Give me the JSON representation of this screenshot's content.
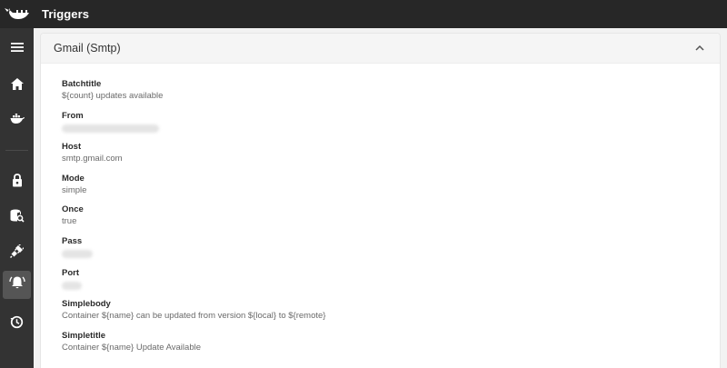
{
  "app": {
    "title": "Triggers",
    "logo_icon": "whale-logo-icon"
  },
  "sidebar": {
    "items": [
      {
        "icon": "menu-icon",
        "active": false
      },
      {
        "icon": "home-icon",
        "active": false
      },
      {
        "icon": "docker-whale-icon",
        "active": false
      },
      {
        "icon": "lock-icon",
        "active": false
      },
      {
        "icon": "database-search-icon",
        "active": false
      },
      {
        "icon": "plug-icon",
        "active": false
      },
      {
        "icon": "bell-alarm-icon",
        "active": true
      },
      {
        "icon": "history-icon",
        "active": false
      }
    ]
  },
  "panel": {
    "title": "Gmail (Smtp)",
    "expanded": true,
    "fields": [
      {
        "label": "Batchtitle",
        "value": "${count} updates available",
        "redacted": false
      },
      {
        "label": "From",
        "value": "",
        "redacted": true
      },
      {
        "label": "Host",
        "value": "smtp.gmail.com",
        "redacted": false
      },
      {
        "label": "Mode",
        "value": "simple",
        "redacted": false
      },
      {
        "label": "Once",
        "value": "true",
        "redacted": false
      },
      {
        "label": "Pass",
        "value": "",
        "redacted": true
      },
      {
        "label": "Port",
        "value": "",
        "redacted": true
      },
      {
        "label": "Simplebody",
        "value": "Container ${name} can be updated from version ${local} to ${remote}",
        "redacted": false
      },
      {
        "label": "Simpletitle",
        "value": "Container ${name} Update Available",
        "redacted": false
      }
    ]
  },
  "colors": {
    "appbar": "#272727",
    "sidebar": "#333333",
    "active_item": "#555555",
    "background": "#f2f2f2"
  }
}
